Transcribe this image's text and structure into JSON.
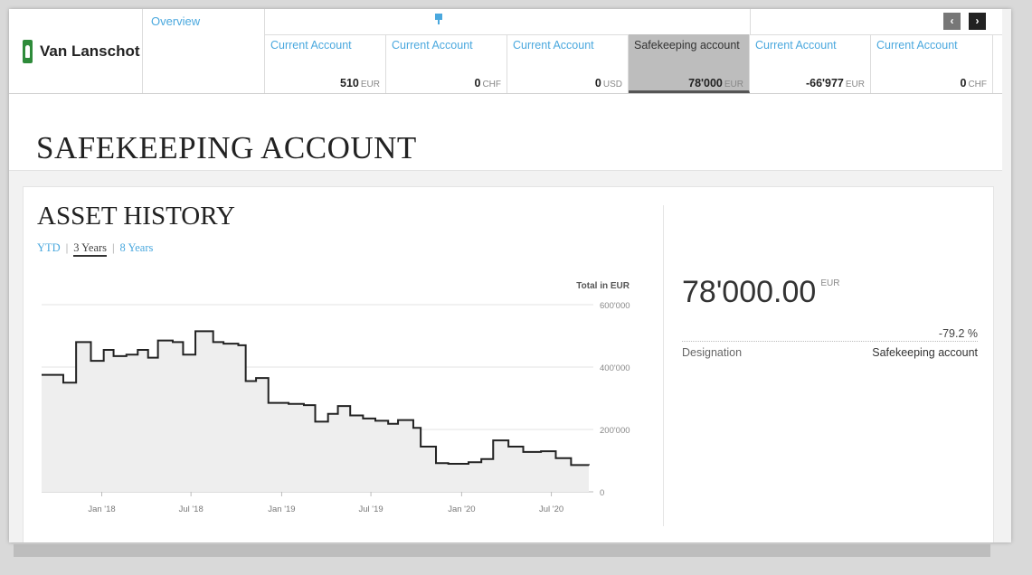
{
  "brand": {
    "name": "Van Lanschot",
    "logo_icon": "tree-logo-icon",
    "color": "#2e8b3a"
  },
  "nav": {
    "overview_label": "Overview",
    "pin_icon": "pin-icon",
    "prev_icon": "‹",
    "next_icon": "›"
  },
  "accounts": [
    {
      "name": "Current Account",
      "balance": "510",
      "currency": "EUR",
      "selected": false
    },
    {
      "name": "Current Account",
      "balance": "0",
      "currency": "CHF",
      "selected": false
    },
    {
      "name": "Current Account",
      "balance": "0",
      "currency": "USD",
      "selected": false
    },
    {
      "name": "Safekeeping account",
      "balance": "78'000",
      "currency": "EUR",
      "selected": true
    },
    {
      "name": "Current Account",
      "balance": "-66'977",
      "currency": "EUR",
      "selected": false
    },
    {
      "name": "Current Account",
      "balance": "0",
      "currency": "CHF",
      "selected": false
    }
  ],
  "page": {
    "title": "SAFEKEEPING ACCOUNT"
  },
  "asset_history": {
    "title": "ASSET HISTORY",
    "ranges": [
      "YTD",
      "3 Years",
      "8 Years"
    ],
    "active_range": "3 Years"
  },
  "summary": {
    "value": "78'000.00",
    "currency": "EUR",
    "change": "-79.2 %",
    "designation_label": "Designation",
    "designation_value": "Safekeeping account"
  },
  "colors": {
    "accent": "#4aa8de",
    "selected_tab": "#bdbdbd"
  },
  "chart_data": {
    "type": "area",
    "step": true,
    "ylabel": "Total in EUR",
    "y_ticks": [
      "600'000",
      "400'000",
      "200'000",
      "0"
    ],
    "ylim": [
      0,
      600000
    ],
    "y_tick_values": [
      600000,
      400000,
      200000,
      0
    ],
    "x_ticks": [
      "Jan '18",
      "Jul '18",
      "Jan '19",
      "Jul '19",
      "Jan '20",
      "Jul '20"
    ],
    "x_tick_dates": [
      "2018-01-01",
      "2018-07-01",
      "2019-01-01",
      "2019-07-01",
      "2020-01-01",
      "2020-07-01"
    ],
    "xlim": [
      "2017-09-01",
      "2020-09-15"
    ],
    "grid": true,
    "series": [
      {
        "dates": [
          "2017-09-01",
          "2017-10-15",
          "2017-11-10",
          "2017-12-10",
          "2018-01-05",
          "2018-01-25",
          "2018-02-20",
          "2018-03-15",
          "2018-04-05",
          "2018-04-25",
          "2018-05-25",
          "2018-06-15",
          "2018-07-10",
          "2018-08-15",
          "2018-09-05",
          "2018-10-05",
          "2018-10-20",
          "2018-11-10",
          "2018-12-05",
          "2019-01-15",
          "2019-02-15",
          "2019-03-10",
          "2019-04-05",
          "2019-04-25",
          "2019-05-20",
          "2019-06-15",
          "2019-07-10",
          "2019-08-05",
          "2019-08-25",
          "2019-09-10",
          "2019-09-25",
          "2019-10-10",
          "2019-11-10",
          "2019-12-05",
          "2020-01-15",
          "2020-02-10",
          "2020-03-05",
          "2020-04-05",
          "2020-05-05",
          "2020-06-10",
          "2020-07-10",
          "2020-08-10",
          "2020-09-15"
        ],
        "values": [
          375000,
          350000,
          480000,
          420000,
          455000,
          435000,
          440000,
          455000,
          430000,
          485000,
          480000,
          440000,
          515000,
          480000,
          475000,
          470000,
          355000,
          365000,
          285000,
          282000,
          278000,
          225000,
          250000,
          275000,
          245000,
          235000,
          228000,
          218000,
          230000,
          230000,
          205000,
          145000,
          92000,
          90000,
          95000,
          105000,
          165000,
          145000,
          128000,
          130000,
          108000,
          86000,
          85000
        ]
      }
    ]
  }
}
